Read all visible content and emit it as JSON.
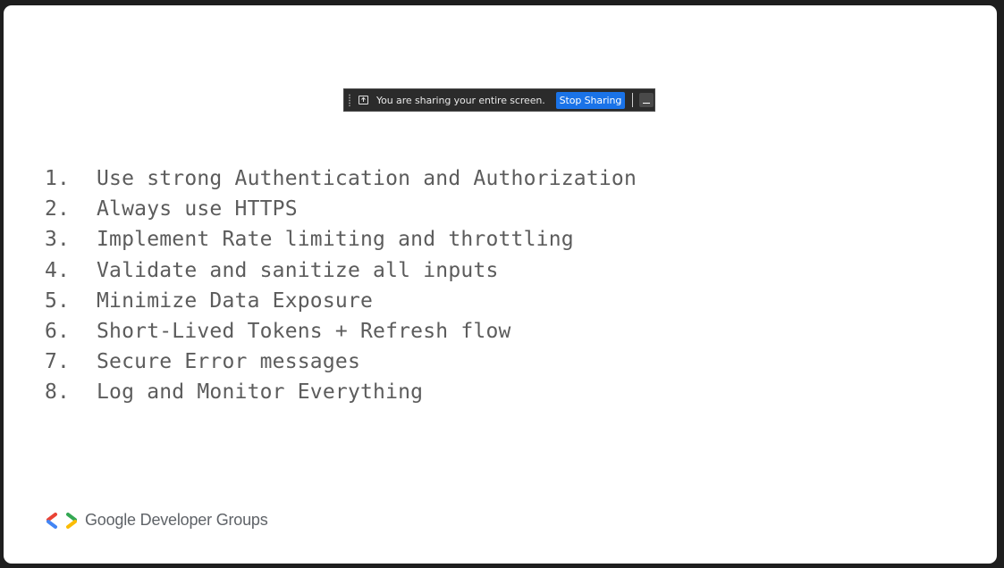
{
  "share_bar": {
    "message": "You are sharing your entire screen.",
    "stop_label": "Stop Sharing",
    "minimize_icon": "minimize-icon",
    "share_icon": "screen-share-icon"
  },
  "list": {
    "items": [
      {
        "num": "1.",
        "text": "Use strong Authentication and Authorization"
      },
      {
        "num": "2.",
        "text": "Always use HTTPS"
      },
      {
        "num": "3.",
        "text": "Implement Rate limiting and throttling"
      },
      {
        "num": "4.",
        "text": "Validate and sanitize all inputs"
      },
      {
        "num": "5.",
        "text": "Minimize Data Exposure"
      },
      {
        "num": "6.",
        "text": "Short-Lived Tokens + Refresh flow"
      },
      {
        "num": "7.",
        "text": "Secure Error messages"
      },
      {
        "num": "8.",
        "text": "Log and Monitor Everything"
      }
    ]
  },
  "footer": {
    "brand": "Google Developer Groups"
  },
  "colors": {
    "bar_bg": "#2b2b2b",
    "stop_button": "#1a73e8",
    "list_text": "#5c5c5c",
    "logo_red": "#ea4335",
    "logo_blue": "#4285f4",
    "logo_green": "#34a853",
    "logo_yellow": "#fbbc04"
  }
}
